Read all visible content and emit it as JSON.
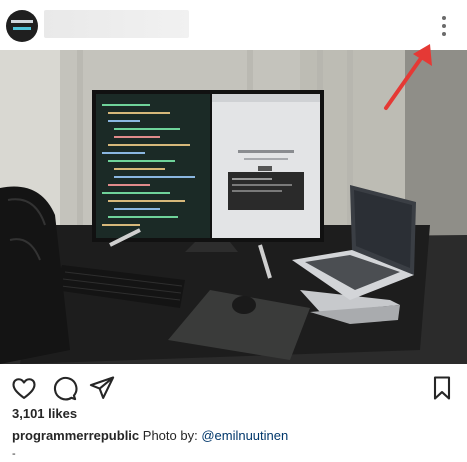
{
  "post": {
    "header": {
      "avatar_icon": "brand-logo-avatar",
      "more_icon": "more-vertical-icon"
    },
    "photo": {
      "subject": "desk-setup-photo"
    },
    "annotation": {
      "arrow_icon": "red-arrow-icon",
      "arrow_color": "#e53935"
    },
    "actions": {
      "like_icon": "heart-icon",
      "comment_icon": "comment-icon",
      "share_icon": "send-icon",
      "save_icon": "bookmark-icon"
    },
    "likes_text": "3,101 likes",
    "caption": {
      "username": "programmerrepublic",
      "text": " Photo by: ",
      "mention": "@emilnuutinen"
    },
    "trailing": "-"
  }
}
